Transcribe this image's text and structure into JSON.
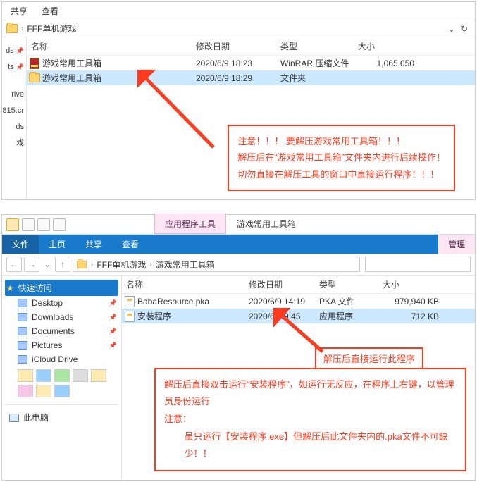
{
  "s1": {
    "toolbar": {
      "share": "共享",
      "view": "查看"
    },
    "location": "FFF单机游戏",
    "columns": {
      "name": "名称",
      "date": "修改日期",
      "type": "类型",
      "size": "大小"
    },
    "quick_items": [
      "ds",
      "ts",
      "rive",
      "815.cr",
      "ds",
      "戏"
    ],
    "rows": [
      {
        "name": "游戏常用工具箱",
        "date": "2020/6/9 18:23",
        "type": "WinRAR 压缩文件",
        "size": "1,065,050",
        "icon": "rar"
      },
      {
        "name": "游戏常用工具箱",
        "date": "2020/6/9 18:29",
        "type": "文件夹",
        "size": "",
        "icon": "folder",
        "selected": true
      }
    ],
    "note": {
      "l1": "注意！！！ 要解压游戏常用工具箱！！！",
      "l2": "解压后在“游戏常用工具箱”文件夹内进行后续操作！",
      "l3": "切勿直接在解压工具的窗口中直接运行程序！！！"
    }
  },
  "s2": {
    "ribbon": {
      "tools_tab": "应用程序工具",
      "title": "游戏常用工具箱"
    },
    "menu": {
      "file": "文件",
      "home": "主页",
      "share": "共享",
      "view": "查看",
      "manage": "管理"
    },
    "crumbs": {
      "c1": "FFF单机游戏",
      "c2": "游戏常用工具箱"
    },
    "columns": {
      "name": "名称",
      "date": "修改日期",
      "type": "类型",
      "size": "大小"
    },
    "tree": {
      "quick": "快速访问",
      "items": [
        "Desktop",
        "Downloads",
        "Documents",
        "Pictures",
        "iCloud Drive"
      ],
      "pc": "此电脑"
    },
    "rows": [
      {
        "name": "BabaResource.pka",
        "date": "2020/6/9 14:19",
        "type": "PKA 文件",
        "size": "979,940 KB",
        "icon": "file"
      },
      {
        "name": "安装程序",
        "date": "2020/6/8 9:45",
        "type": "应用程序",
        "size": "712 KB",
        "icon": "exe",
        "selected": true
      }
    ],
    "note_a": "解压后直接运行此程序",
    "note_b": {
      "l1": "解压后直接双击运行“安装程序”，如运行无反应，在程序上右键，以管理员身份运行",
      "l2": "注意：",
      "l3": "虽只运行【安装程序.exe】但解压后此文件夹内的.pka文件不可缺少！！"
    }
  }
}
